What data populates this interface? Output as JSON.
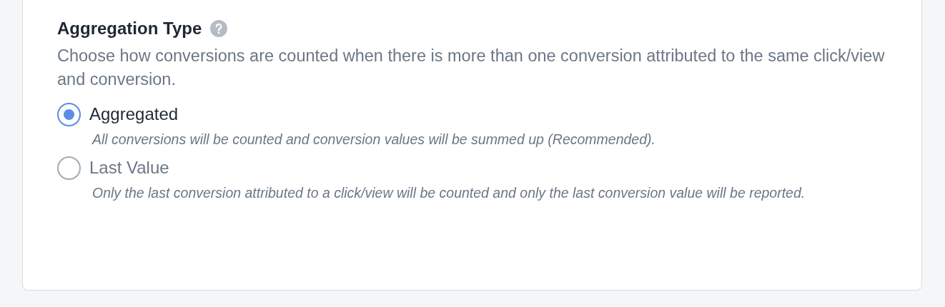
{
  "section": {
    "title": "Aggregation Type",
    "description": "Choose how conversions are counted when there is more than one conversion attributed to the same click/view and conversion.",
    "options": [
      {
        "label": "Aggregated",
        "hint": "All conversions will be counted and conversion values will be summed up (Recommended).",
        "selected": true
      },
      {
        "label": "Last Value",
        "hint": "Only the last conversion attributed to a click/view will be counted and only the last conversion value will be reported.",
        "selected": false
      }
    ]
  }
}
